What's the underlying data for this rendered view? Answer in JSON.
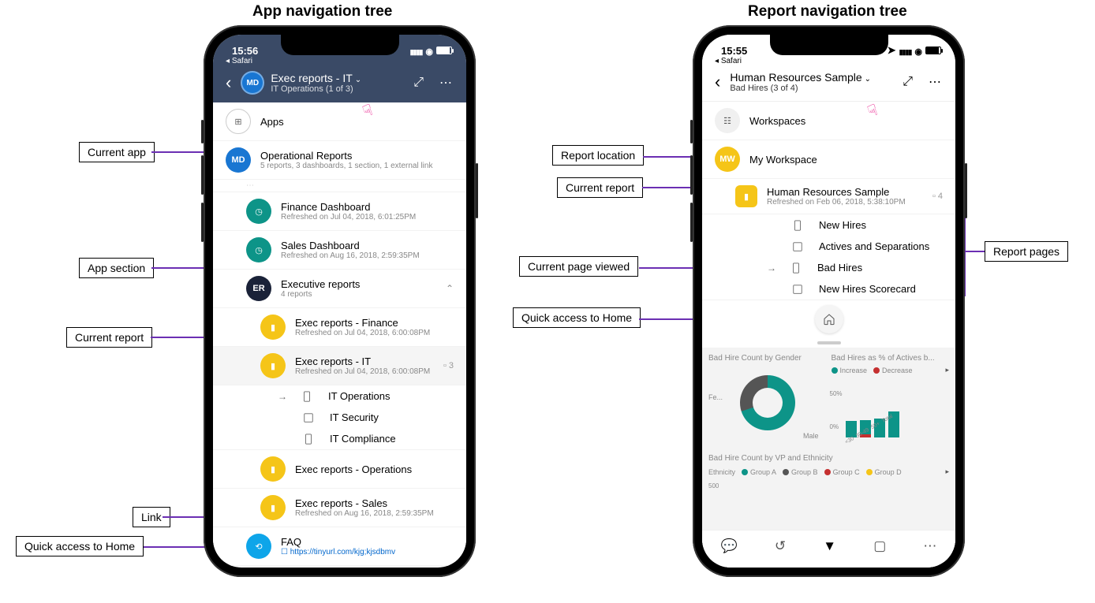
{
  "titles": {
    "left": "App navigation tree",
    "right": "Report navigation tree"
  },
  "left": {
    "status_time": "15:56",
    "back_app": "Safari",
    "header": {
      "avatar": "MD",
      "title": "Exec reports - IT",
      "subtitle": "IT Operations (1 of 3)"
    },
    "apps_label": "Apps",
    "current_app": {
      "avatar": "MD",
      "title": "Operational Reports",
      "sub": "5 reports, 3 dashboards, 1 section, 1 external link"
    },
    "dash1": {
      "title": "Finance Dashboard",
      "sub": "Refreshed on Jul 04, 2018, 6:01:25PM"
    },
    "dash2": {
      "title": "Sales Dashboard",
      "sub": "Refreshed on Aug 16, 2018, 2:59:35PM"
    },
    "section": {
      "avatar": "ER",
      "title": "Executive reports",
      "sub": "4 reports"
    },
    "rep1": {
      "title": "Exec reports - Finance",
      "sub": "Refreshed on Jul 04, 2018, 6:00:08PM"
    },
    "rep2": {
      "title": "Exec reports - IT",
      "sub": "Refreshed on Jul 04, 2018, 6:00:08PM",
      "count": "3"
    },
    "pages": {
      "p1": "IT Operations",
      "p2": "IT Security",
      "p3": "IT Compliance"
    },
    "rep3": {
      "title": "Exec reports - Operations"
    },
    "rep4": {
      "title": "Exec reports - Sales",
      "sub": "Refreshed on Aug 16, 2018, 2:59:35PM"
    },
    "link": {
      "title": "FAQ",
      "url": "https://tinyurl.com/kjg;kjsdbmv"
    }
  },
  "right": {
    "status_time": "15:55",
    "back_app": "Safari",
    "header": {
      "title": "Human Resources Sample",
      "subtitle": "Bad Hires (3 of 4)"
    },
    "workspaces_label": "Workspaces",
    "my_workspace": {
      "avatar": "MW",
      "title": "My Workspace"
    },
    "report": {
      "title": "Human Resources Sample",
      "sub": "Refreshed on Feb 06, 2018, 5:38:10PM",
      "count": "4"
    },
    "pages": {
      "p1": "New Hires",
      "p2": "Actives and Separations",
      "p3": "Bad Hires",
      "p4": "New Hires Scorecard"
    },
    "chart_titles": {
      "c1": "Bad Hire Count by Gender",
      "c2": "Bad Hires as % of Actives b...",
      "c3": "Bad Hire Count by VP and Ethnicity"
    },
    "legend_increase": "Increase",
    "legend_decrease": "Decrease",
    "donut_labels": {
      "fe": "Fe...",
      "male": "Male"
    },
    "bar_labels": {
      "b1": "<30",
      "b2": "30-49",
      "b3": "50+",
      "b4": "Total",
      "y1": "50%",
      "y2": "0%"
    },
    "ethnicity_label": "Ethnicity",
    "groups": {
      "a": "Group A",
      "b": "Group B",
      "c": "Group C",
      "d": "Group D"
    },
    "y500": "500"
  },
  "callouts": {
    "current_app": "Current app",
    "app_section": "App section",
    "current_report": "Current report",
    "link": "Link",
    "home": "Quick access to Home",
    "report_location": "Report location",
    "current_report_r": "Current report",
    "current_page": "Current page viewed",
    "home_r": "Quick access to Home",
    "report_pages": "Report pages"
  },
  "chart_data": [
    {
      "type": "pie",
      "title": "Bad Hire Count by Gender",
      "series": [
        {
          "name": "Female",
          "value": 70
        },
        {
          "name": "Male",
          "value": 30
        }
      ]
    },
    {
      "type": "bar",
      "title": "Bad Hires as % of Actives",
      "categories": [
        "<30",
        "30-49",
        "50+",
        "Total"
      ],
      "series": [
        {
          "name": "Increase",
          "values": [
            35,
            20,
            40,
            50
          ]
        },
        {
          "name": "Decrease",
          "values": [
            0,
            -5,
            0,
            0
          ]
        }
      ],
      "ylabel": "%",
      "ylim": [
        0,
        50
      ]
    }
  ]
}
